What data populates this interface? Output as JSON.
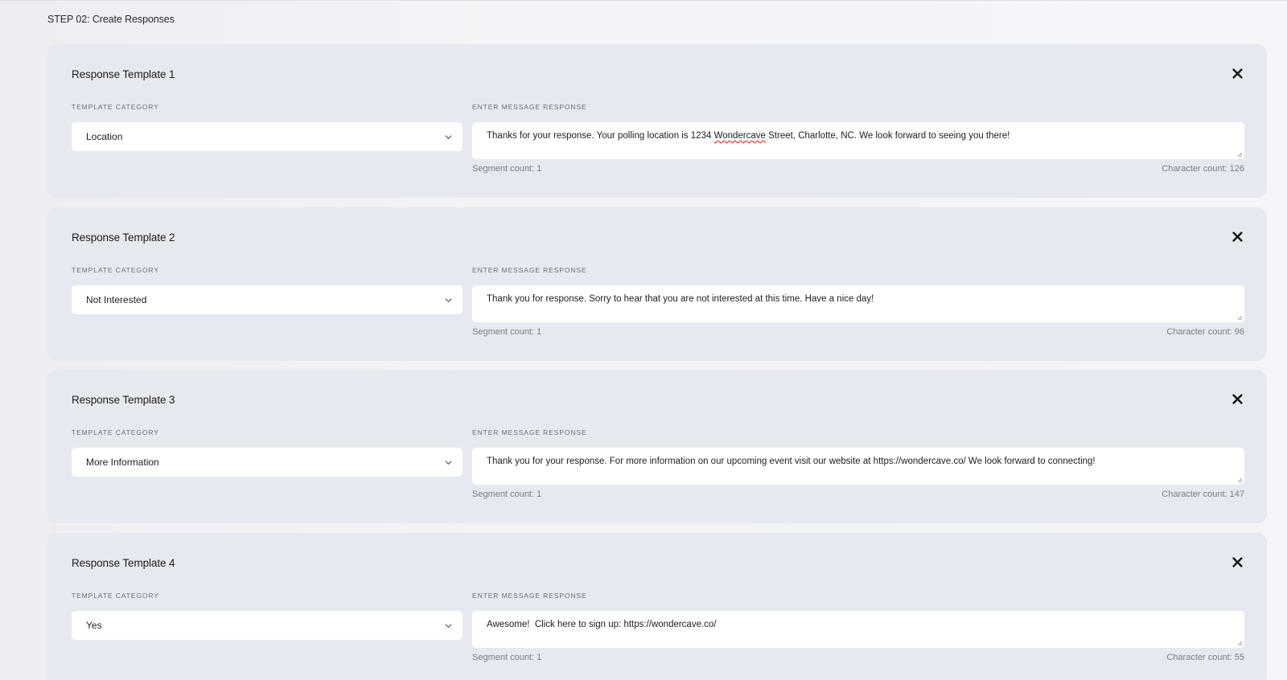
{
  "step_title": "STEP 02: Create Responses",
  "labels": {
    "category": "TEMPLATE CATEGORY",
    "message": "ENTER MESSAGE RESPONSE"
  },
  "icons": {
    "close": "close-icon",
    "dropdown": "chevron-down-icon",
    "resize": "resize-grip-icon"
  },
  "templates": [
    {
      "title": "Response Template 1",
      "category": "Location",
      "message": "Thanks for your response. Your polling location is 1234 Wondercave Street, Charlotte, NC. We look forward to seeing you there!",
      "segment": "Segment count: 1",
      "characters": "Character count: 126"
    },
    {
      "title": "Response Template 2",
      "category": "Not Interested",
      "message": "Thank you for response. Sorry to hear that you are not interested at this time. Have a nice day!",
      "segment": "Segment count: 1",
      "characters": "Character count: 96"
    },
    {
      "title": "Response Template 3",
      "category": "More Information",
      "message": "Thank you for your response. For more information on our upcoming event visit our website at https://wondercave.co/ We look forward to connecting!",
      "segment": "Segment count: 1",
      "characters": "Character count: 147"
    },
    {
      "title": "Response Template 4",
      "category": "Yes",
      "message": "Awesome!  Click here to sign up: https://wondercave.co/",
      "segment": "Segment count: 1",
      "characters": "Character count: 55"
    }
  ]
}
